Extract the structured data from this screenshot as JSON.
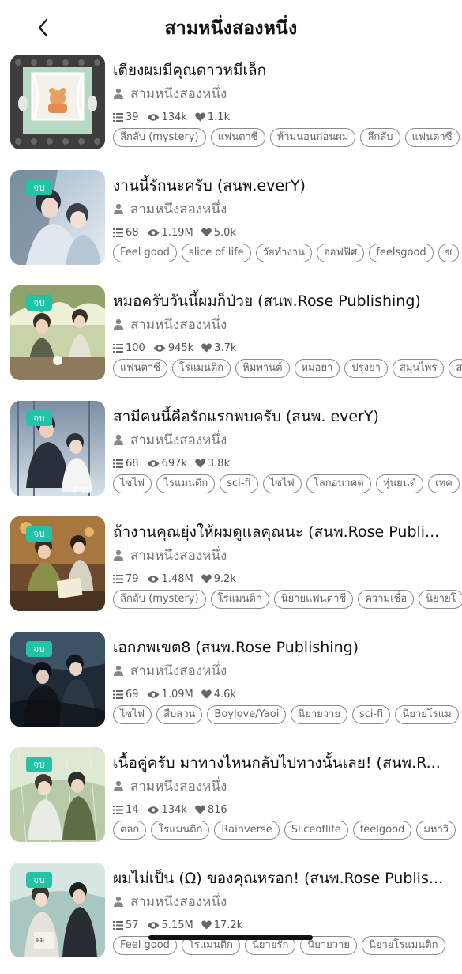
{
  "header": {
    "title": "สามหนึ่งสองหนึ่ง",
    "back_icon": "chevron-left-icon"
  },
  "colors": {
    "badge": "#22c3a6",
    "text": "#111111",
    "muted": "#777777"
  },
  "novels": [
    {
      "title": "เตียงผมมีคุณดาวหมีเล็ก",
      "author": "สามหนึ่งสองหนึ่ง",
      "completed_badge": "",
      "chapters": "39",
      "views": "134k",
      "likes": "1.1k",
      "tags": [
        "ลึกลับ (mystery)",
        "แฟนตาซี",
        "ห้ามนอนก่อนผม",
        "ลึกลับ",
        "แฟนตาซี"
      ]
    },
    {
      "title": "งานนี้รักนะครับ (สนพ.everY)",
      "author": "สามหนึ่งสองหนึ่ง",
      "completed_badge": "จบ",
      "chapters": "68",
      "views": "1.19M",
      "likes": "5.0k",
      "tags": [
        "Feel good",
        "slice of life",
        "วัยทำงาน",
        "ออฟฟิศ",
        "feelsgood",
        "ซ"
      ]
    },
    {
      "title": "หมอครับวันนี้ผมก็ป่วย (สนพ.Rose Publishing)",
      "author": "สามหนึ่งสองหนึ่ง",
      "completed_badge": "จบ",
      "chapters": "100",
      "views": "945k",
      "likes": "3.7k",
      "tags": [
        "แฟนตาซี",
        "โรแมนติก",
        "หิมพานต์",
        "หมอยา",
        "ปรุงยา",
        "สมุนไพร",
        "ส"
      ]
    },
    {
      "title": "สามีคนนี้คือรักแรกพบครับ (สนพ. everY)",
      "author": "สามหนึ่งสองหนึ่ง",
      "completed_badge": "จบ",
      "chapters": "68",
      "views": "697k",
      "likes": "3.8k",
      "tags": [
        "ไซไฟ",
        "โรแมนติก",
        "sci-fi",
        "ไซไฟ",
        "โลกอนาคต",
        "หุ่นยนต์",
        "เทค"
      ]
    },
    {
      "title": "ถ้างานคุณยุ่งให้ผมดูแลคุณนะ (สนพ.Rose Publi...",
      "author": "สามหนึ่งสองหนึ่ง",
      "completed_badge": "จบ",
      "chapters": "79",
      "views": "1.48M",
      "likes": "9.2k",
      "tags": [
        "ลึกลับ (mystery)",
        "โรแมนติก",
        "นิยายแฟนตาซี",
        "ความเชื่อ",
        "นิยายโ"
      ]
    },
    {
      "title": "เอกภพเขต8 (สนพ.Rose Publishing)",
      "author": "สามหนึ่งสองหนึ่ง",
      "completed_badge": "จบ",
      "chapters": "69",
      "views": "1.09M",
      "likes": "4.6k",
      "tags": [
        "ไซไฟ",
        "สืบสวน",
        "Boylove/Yaoi",
        "นิยายวาย",
        "sci-fi",
        "นิยายโรแม"
      ]
    },
    {
      "title": "เนื้อคู่ครับ มาทางไหนกลับไปทางนั้นเลย! (สนพ.R...",
      "author": "สามหนึ่งสองหนึ่ง",
      "completed_badge": "จบ",
      "chapters": "14",
      "views": "134k",
      "likes": "816",
      "tags": [
        "ตลก",
        "โรแมนติก",
        "Rainverse",
        "Sliceoflife",
        "feelgood",
        "มหาวิ"
      ]
    },
    {
      "title": "ผมไม่เป็น (Ω) ของคุณหรอก! (สนพ.Rose Publis...",
      "author": "สามหนึ่งสองหนึ่ง",
      "completed_badge": "จบ",
      "chapters": "57",
      "views": "5.15M",
      "likes": "17.2k",
      "tags": [
        "Feel good",
        "โรแมนติก",
        "นิยายรัก",
        "นิยายวาย",
        "นิยายโรแมนติก"
      ]
    }
  ]
}
